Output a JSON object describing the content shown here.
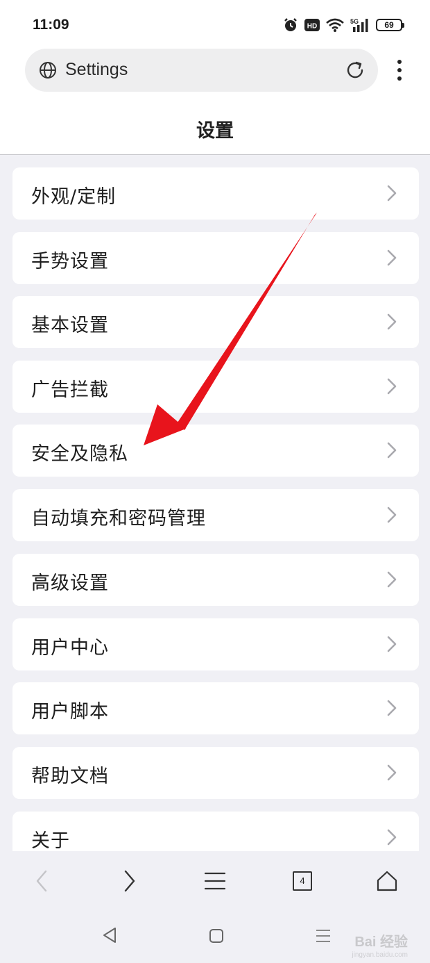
{
  "status_bar": {
    "time": "11:09",
    "battery": "69",
    "network": "5G",
    "hd": "HD"
  },
  "url_bar": {
    "text": "Settings"
  },
  "page": {
    "title": "设置"
  },
  "settings": [
    {
      "label": "外观/定制"
    },
    {
      "label": "手势设置"
    },
    {
      "label": "基本设置"
    },
    {
      "label": "广告拦截"
    },
    {
      "label": "安全及隐私"
    },
    {
      "label": "自动填充和密码管理"
    },
    {
      "label": "高级设置"
    },
    {
      "label": "用户中心"
    },
    {
      "label": "用户脚本"
    },
    {
      "label": "帮助文档"
    },
    {
      "label": "关于"
    }
  ],
  "bottom_bar": {
    "tab_count": "4"
  },
  "watermark": {
    "text": "Bai 经验",
    "sub": "jingyan.baidu.com"
  },
  "colors": {
    "background": "#f0f0f5",
    "card": "#ffffff",
    "annotation_arrow": "#e8141c"
  }
}
